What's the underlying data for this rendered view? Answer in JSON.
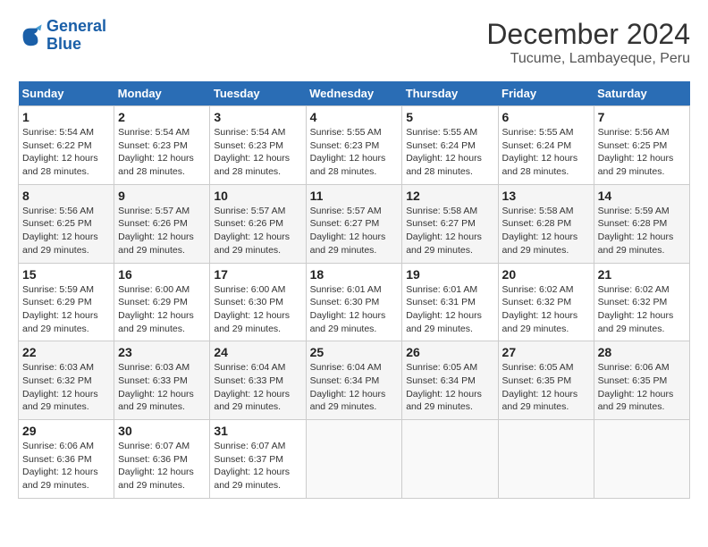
{
  "logo": {
    "line1": "General",
    "line2": "Blue"
  },
  "title": "December 2024",
  "subtitle": "Tucume, Lambayeque, Peru",
  "headers": [
    "Sunday",
    "Monday",
    "Tuesday",
    "Wednesday",
    "Thursday",
    "Friday",
    "Saturday"
  ],
  "weeks": [
    [
      {
        "day": "1",
        "sunrise": "5:54 AM",
        "sunset": "6:22 PM",
        "daylight": "12 hours and 28 minutes."
      },
      {
        "day": "2",
        "sunrise": "5:54 AM",
        "sunset": "6:23 PM",
        "daylight": "12 hours and 28 minutes."
      },
      {
        "day": "3",
        "sunrise": "5:54 AM",
        "sunset": "6:23 PM",
        "daylight": "12 hours and 28 minutes."
      },
      {
        "day": "4",
        "sunrise": "5:55 AM",
        "sunset": "6:23 PM",
        "daylight": "12 hours and 28 minutes."
      },
      {
        "day": "5",
        "sunrise": "5:55 AM",
        "sunset": "6:24 PM",
        "daylight": "12 hours and 28 minutes."
      },
      {
        "day": "6",
        "sunrise": "5:55 AM",
        "sunset": "6:24 PM",
        "daylight": "12 hours and 28 minutes."
      },
      {
        "day": "7",
        "sunrise": "5:56 AM",
        "sunset": "6:25 PM",
        "daylight": "12 hours and 29 minutes."
      }
    ],
    [
      {
        "day": "8",
        "sunrise": "5:56 AM",
        "sunset": "6:25 PM",
        "daylight": "12 hours and 29 minutes."
      },
      {
        "day": "9",
        "sunrise": "5:57 AM",
        "sunset": "6:26 PM",
        "daylight": "12 hours and 29 minutes."
      },
      {
        "day": "10",
        "sunrise": "5:57 AM",
        "sunset": "6:26 PM",
        "daylight": "12 hours and 29 minutes."
      },
      {
        "day": "11",
        "sunrise": "5:57 AM",
        "sunset": "6:27 PM",
        "daylight": "12 hours and 29 minutes."
      },
      {
        "day": "12",
        "sunrise": "5:58 AM",
        "sunset": "6:27 PM",
        "daylight": "12 hours and 29 minutes."
      },
      {
        "day": "13",
        "sunrise": "5:58 AM",
        "sunset": "6:28 PM",
        "daylight": "12 hours and 29 minutes."
      },
      {
        "day": "14",
        "sunrise": "5:59 AM",
        "sunset": "6:28 PM",
        "daylight": "12 hours and 29 minutes."
      }
    ],
    [
      {
        "day": "15",
        "sunrise": "5:59 AM",
        "sunset": "6:29 PM",
        "daylight": "12 hours and 29 minutes."
      },
      {
        "day": "16",
        "sunrise": "6:00 AM",
        "sunset": "6:29 PM",
        "daylight": "12 hours and 29 minutes."
      },
      {
        "day": "17",
        "sunrise": "6:00 AM",
        "sunset": "6:30 PM",
        "daylight": "12 hours and 29 minutes."
      },
      {
        "day": "18",
        "sunrise": "6:01 AM",
        "sunset": "6:30 PM",
        "daylight": "12 hours and 29 minutes."
      },
      {
        "day": "19",
        "sunrise": "6:01 AM",
        "sunset": "6:31 PM",
        "daylight": "12 hours and 29 minutes."
      },
      {
        "day": "20",
        "sunrise": "6:02 AM",
        "sunset": "6:32 PM",
        "daylight": "12 hours and 29 minutes."
      },
      {
        "day": "21",
        "sunrise": "6:02 AM",
        "sunset": "6:32 PM",
        "daylight": "12 hours and 29 minutes."
      }
    ],
    [
      {
        "day": "22",
        "sunrise": "6:03 AM",
        "sunset": "6:32 PM",
        "daylight": "12 hours and 29 minutes."
      },
      {
        "day": "23",
        "sunrise": "6:03 AM",
        "sunset": "6:33 PM",
        "daylight": "12 hours and 29 minutes."
      },
      {
        "day": "24",
        "sunrise": "6:04 AM",
        "sunset": "6:33 PM",
        "daylight": "12 hours and 29 minutes."
      },
      {
        "day": "25",
        "sunrise": "6:04 AM",
        "sunset": "6:34 PM",
        "daylight": "12 hours and 29 minutes."
      },
      {
        "day": "26",
        "sunrise": "6:05 AM",
        "sunset": "6:34 PM",
        "daylight": "12 hours and 29 minutes."
      },
      {
        "day": "27",
        "sunrise": "6:05 AM",
        "sunset": "6:35 PM",
        "daylight": "12 hours and 29 minutes."
      },
      {
        "day": "28",
        "sunrise": "6:06 AM",
        "sunset": "6:35 PM",
        "daylight": "12 hours and 29 minutes."
      }
    ],
    [
      {
        "day": "29",
        "sunrise": "6:06 AM",
        "sunset": "6:36 PM",
        "daylight": "12 hours and 29 minutes."
      },
      {
        "day": "30",
        "sunrise": "6:07 AM",
        "sunset": "6:36 PM",
        "daylight": "12 hours and 29 minutes."
      },
      {
        "day": "31",
        "sunrise": "6:07 AM",
        "sunset": "6:37 PM",
        "daylight": "12 hours and 29 minutes."
      },
      null,
      null,
      null,
      null
    ]
  ],
  "labels": {
    "sunrise": "Sunrise: ",
    "sunset": "Sunset: ",
    "daylight": "Daylight: "
  }
}
